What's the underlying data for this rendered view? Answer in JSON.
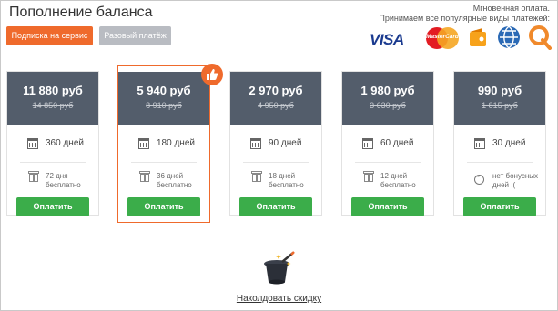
{
  "title": "Пополнение баланса",
  "tabs": [
    {
      "label": "Подписка на сервис",
      "active": true
    },
    {
      "label": "Разовый платёж",
      "active": false
    }
  ],
  "payment_info": {
    "line1": "Мгновенная оплата.",
    "line2": "Принимаем все популярные виды платежей:",
    "methods": [
      "visa-logo",
      "mastercard-logo",
      "yandex-money-logo",
      "webmoney-logo",
      "qiwi-logo"
    ],
    "visa_text": "VISA",
    "mastercard_text": "MasterCard"
  },
  "plans": [
    {
      "price": "11 880 руб",
      "old_price": "14 850 руб",
      "days": "360 дней",
      "bonus_line1": "72 дня",
      "bonus_line2": "бесплатно",
      "bonus_icon": "gift-icon",
      "button": "Оплатить"
    },
    {
      "price": "5 940 руб",
      "old_price": "8 910 руб",
      "days": "180 дней",
      "bonus_line1": "36 дней",
      "bonus_line2": "бесплатно",
      "bonus_icon": "gift-icon",
      "button": "Оплатить",
      "highlight": true
    },
    {
      "price": "2 970 руб",
      "old_price": "4 950 руб",
      "days": "90 дней",
      "bonus_line1": "18 дней",
      "bonus_line2": "бесплатно",
      "bonus_icon": "gift-icon",
      "button": "Оплатить"
    },
    {
      "price": "1 980 руб",
      "old_price": "3 630 руб",
      "days": "60 дней",
      "bonus_line1": "12 дней",
      "bonus_line2": "бесплатно",
      "bonus_icon": "gift-icon",
      "button": "Оплатить"
    },
    {
      "price": "990 руб",
      "old_price": "1 815 руб",
      "days": "30 дней",
      "bonus_line1": "нет бонусных",
      "bonus_line2": "дней :(",
      "bonus_icon": "sad-face-icon",
      "button": "Оплатить"
    }
  ],
  "discount_link": "Наколдовать скидку",
  "colors": {
    "accent": "#ef6a2c",
    "header": "#535d6b",
    "button": "#3bad4a"
  }
}
